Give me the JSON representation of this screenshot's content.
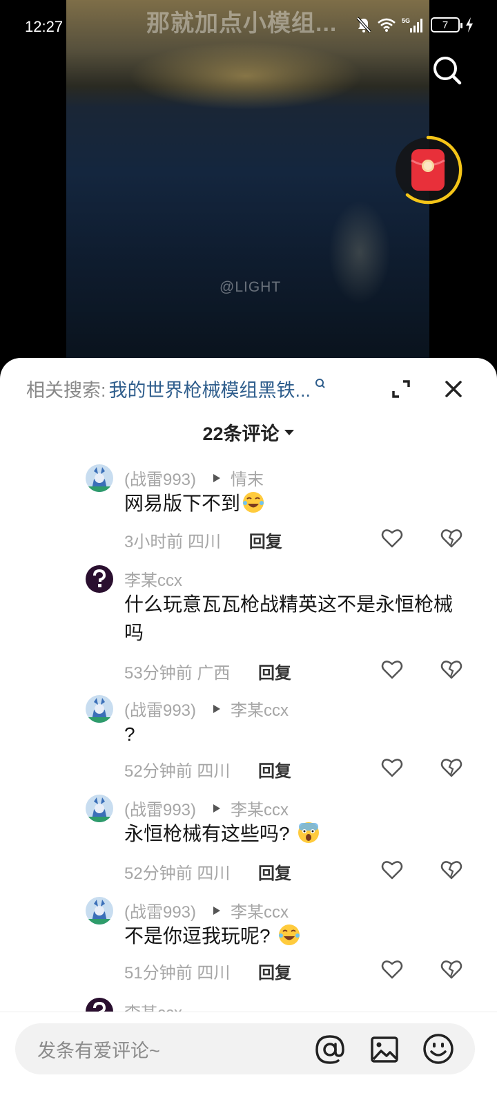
{
  "status_bar": {
    "time": "12:27",
    "battery": "7",
    "network": "5G"
  },
  "video": {
    "overlay_title": "那就加点小模组...",
    "watermark": "@LIGHT"
  },
  "related_search": {
    "label": "相关搜索:",
    "query": "我的世界枪械模组黑铁..."
  },
  "comments_header": {
    "count_label": "22条评论"
  },
  "comments": [
    {
      "author": "(战雷993)",
      "reply_to": "情末",
      "text": "网易版下不到",
      "emoji": "laugh-cry",
      "time": "3小时前",
      "location": "四川",
      "reply_label": "回复"
    },
    {
      "author": "李某ccx",
      "reply_to": "",
      "text": "什么玩意瓦瓦枪战精英这不是永恒枪械吗",
      "emoji": "",
      "time": "53分钟前",
      "location": "广西",
      "reply_label": "回复"
    },
    {
      "author": "(战雷993)",
      "reply_to": "李某ccx",
      "text": "?",
      "emoji": "",
      "time": "52分钟前",
      "location": "四川",
      "reply_label": "回复"
    },
    {
      "author": "(战雷993)",
      "reply_to": "李某ccx",
      "text": "永恒枪械有这些吗?",
      "emoji": "shocked",
      "time": "52分钟前",
      "location": "四川",
      "reply_label": "回复"
    },
    {
      "author": "(战雷993)",
      "reply_to": "李某ccx",
      "text": "不是你逗我玩呢?",
      "emoji": "laugh-cry",
      "time": "51分钟前",
      "location": "四川",
      "reply_label": "回复"
    },
    {
      "author": "李某ccx",
      "reply_to": "",
      "text": "",
      "emoji": "",
      "time": "",
      "location": "",
      "reply_label": ""
    }
  ],
  "input": {
    "placeholder": "发条有爱评论~"
  },
  "colors": {
    "link_blue": "#2e5d8c",
    "red_packet": "#e8303a",
    "ring_yellow": "#f5c518"
  }
}
